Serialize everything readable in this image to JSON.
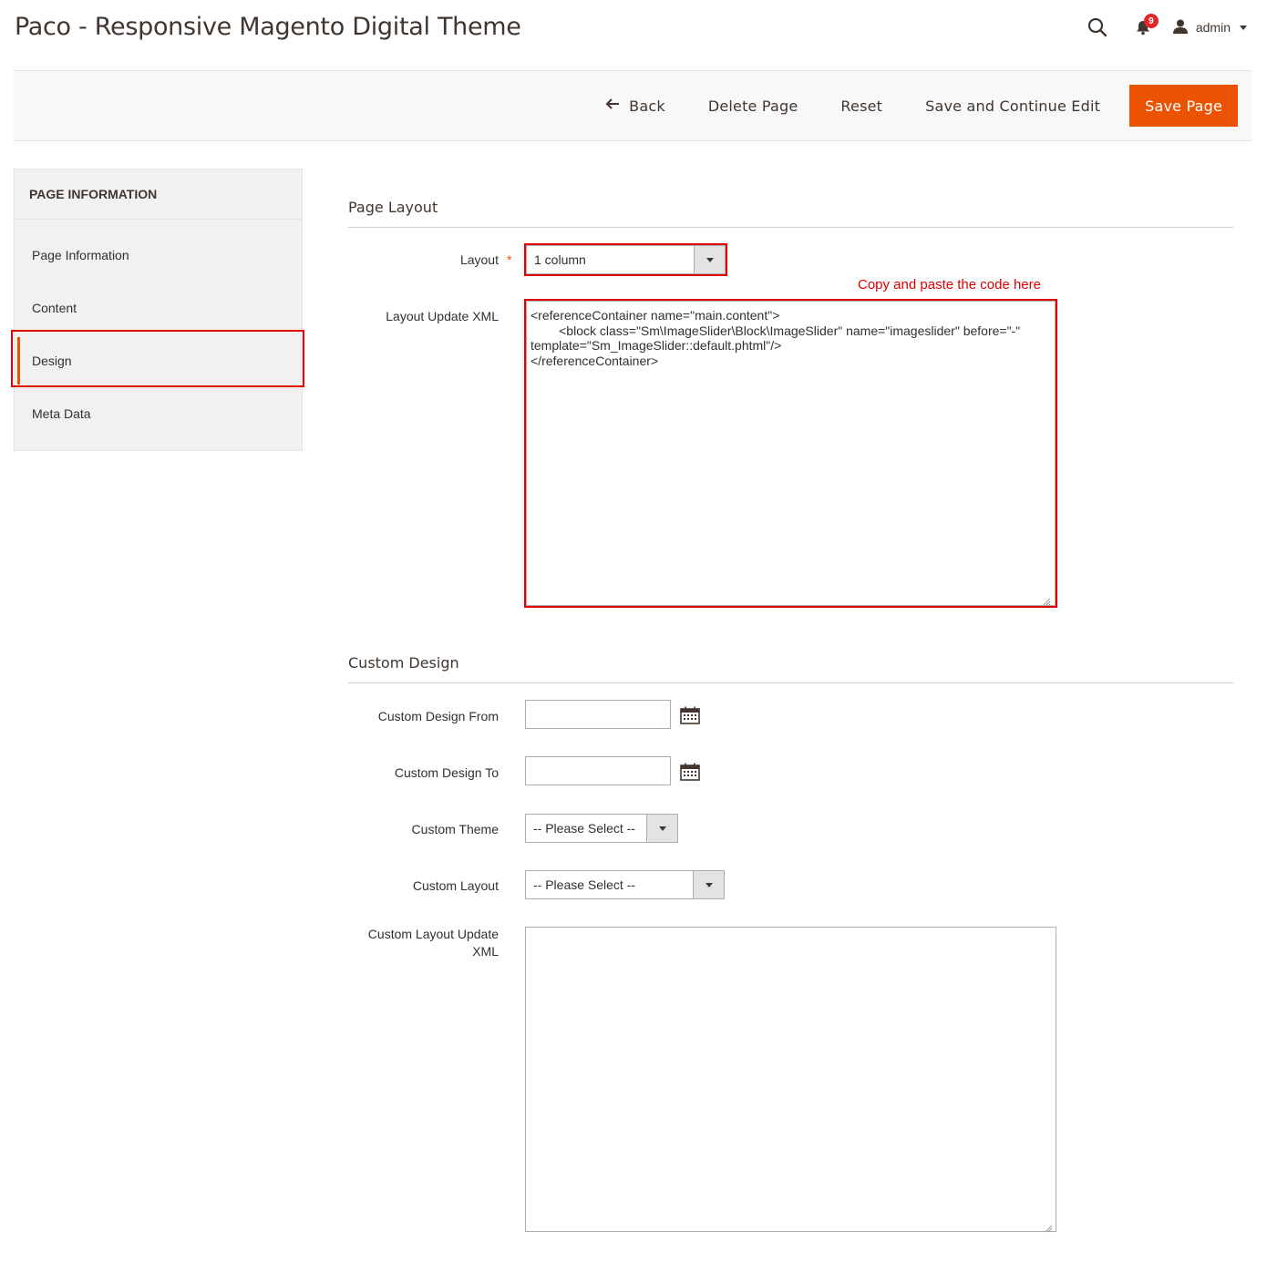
{
  "header": {
    "title": "Paco - Responsive Magento Digital Theme",
    "notifications_count": "9",
    "user_name": "admin"
  },
  "toolbar": {
    "back_label": "Back",
    "delete_label": "Delete Page",
    "reset_label": "Reset",
    "save_continue_label": "Save and Continue Edit",
    "save_label": "Save Page",
    "primary_color": "#eb5202"
  },
  "sidebar": {
    "title": "PAGE INFORMATION",
    "items": [
      {
        "label": "Page Information"
      },
      {
        "label": "Content"
      },
      {
        "label": "Design",
        "active": true
      },
      {
        "label": "Meta Data"
      }
    ]
  },
  "page_layout": {
    "section_title": "Page Layout",
    "layout_label": "Layout",
    "layout_required": "*",
    "layout_value": "1 column",
    "xml_label": "Layout Update XML",
    "xml_value": "<referenceContainer name=\"main.content\">\n        <block class=\"Sm\\ImageSlider\\Block\\ImageSlider\" name=\"imageslider\" before=\"-\"\ntemplate=\"Sm_ImageSlider::default.phtml\"/>\n</referenceContainer>",
    "annotation": "Copy and paste the code here"
  },
  "custom_design": {
    "section_title": "Custom Design",
    "from_label": "Custom Design From",
    "from_value": "",
    "to_label": "Custom Design To",
    "to_value": "",
    "theme_label": "Custom Theme",
    "theme_value": "-- Please Select --",
    "layout_label": "Custom Layout",
    "layout_value": "-- Please Select --",
    "xml_label": "Custom Layout Update XML",
    "xml_value": ""
  }
}
